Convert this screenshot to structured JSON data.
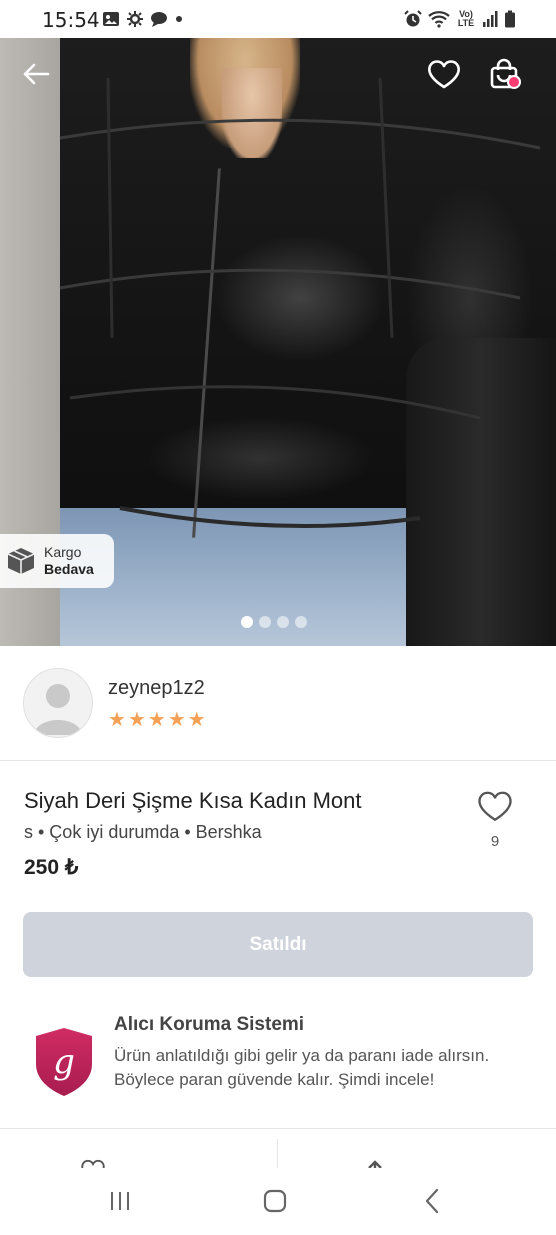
{
  "status_bar": {
    "time": "15:54",
    "icons_left": [
      "gallery-icon",
      "settings-icon",
      "chat-icon",
      "dot-icon"
    ],
    "icons_right": [
      "alarm-icon",
      "wifi-icon",
      "volte-icon",
      "signal-icon",
      "battery-icon"
    ],
    "volte_label": "Vo) LTE"
  },
  "product_gallery": {
    "image_alt": "Siyah deri şişme kısa kadın mont",
    "page_count": 4,
    "active_page": 1,
    "cargo_badge": {
      "line1": "Kargo",
      "line2": "Bedava"
    },
    "top_buttons": [
      "back-icon",
      "heart-icon",
      "shopping-bag-icon"
    ],
    "cart_badge_color": "#ff3d73"
  },
  "seller": {
    "username": "zeynep1z2",
    "rating": 5,
    "stars": [
      "★",
      "★",
      "★",
      "★",
      "★"
    ],
    "star_color": "#f5a156"
  },
  "product": {
    "title": "Siyah Deri Şişme Kısa Kadın Mont",
    "meta": "s • Çok iyi durumda • Bershka",
    "price": "250 ₺",
    "favorites_count": "9"
  },
  "actions": {
    "sold_label": "Satıldı",
    "sold_button_color": "#ced3dc"
  },
  "buyer_protection": {
    "title": "Alıcı Koruma Sistemi",
    "text": "Ürün anlatıldığı gibi gelir ya da paranı iade alırsın. Böylece paran güvende kalır. Şimdi incele!",
    "logo_letter": "g",
    "logo_color": "#c4245e"
  },
  "nav_bar": {
    "buttons": [
      "recent-apps-icon",
      "home-icon",
      "back-icon"
    ]
  }
}
